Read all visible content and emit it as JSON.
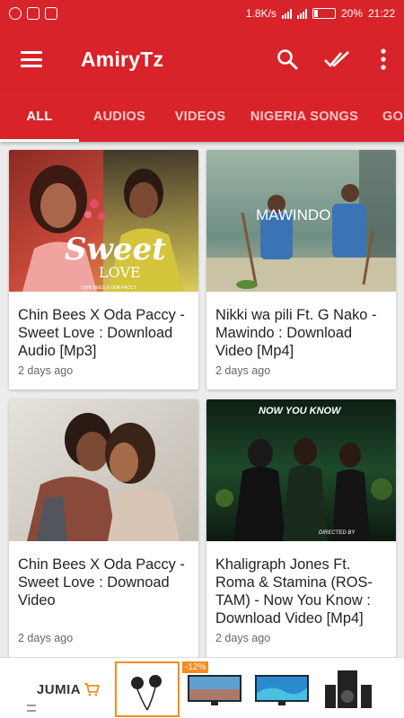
{
  "status_bar": {
    "speed": "1.8K/s",
    "battery": "20%",
    "battery_level": 0.2,
    "time": "21:22",
    "left_icons": [
      "whatsapp-icon",
      "instagram-icon",
      "screenshot-icon"
    ]
  },
  "app_bar": {
    "title": "AmiryTz",
    "actions": [
      "search-icon",
      "double-check-icon",
      "more-vert-icon"
    ]
  },
  "tabs": [
    {
      "label": "ALL",
      "active": true
    },
    {
      "label": "AUDIOS",
      "active": false
    },
    {
      "label": "VIDEOS",
      "active": false
    },
    {
      "label": "NIGERIA SONGS",
      "active": false
    },
    {
      "label": "GOS",
      "active": false
    }
  ],
  "posts": [
    {
      "title": "Chin Bees X Oda Paccy - Sweet Love : Download Audio [Mp3]",
      "date": "2 days ago",
      "thumb_text": "Sweet",
      "thumb_subtext": "LOVE",
      "thumb_caption": "CHIN BEES X ODA PACCY"
    },
    {
      "title": "Nikki wa pili Ft. G Nako - Mawindo : Download Video [Mp4]",
      "date": "2 days ago",
      "thumb_text": "MAWINDO"
    },
    {
      "title": "Chin Bees X Oda Paccy - Sweet Love : Downoad Video",
      "date": "2 days ago"
    },
    {
      "title": "Khaligraph Jones Ft. Roma & Stamina (ROS-TAM) - Now You Know : Download Video [Mp4]",
      "date": "2 days ago",
      "thumb_text": "NOW YOU KNOW",
      "thumb_subtext": "DIRECTED BY"
    }
  ],
  "ad": {
    "brand": "JUMIA",
    "discount": "-12%",
    "products": [
      "earphones-image",
      "smart-tv-image",
      "tv-image",
      "speaker-system-image"
    ]
  },
  "colors": {
    "primary": "#d8232a",
    "background": "#ececec",
    "discount_badge": "#f68b1e"
  }
}
